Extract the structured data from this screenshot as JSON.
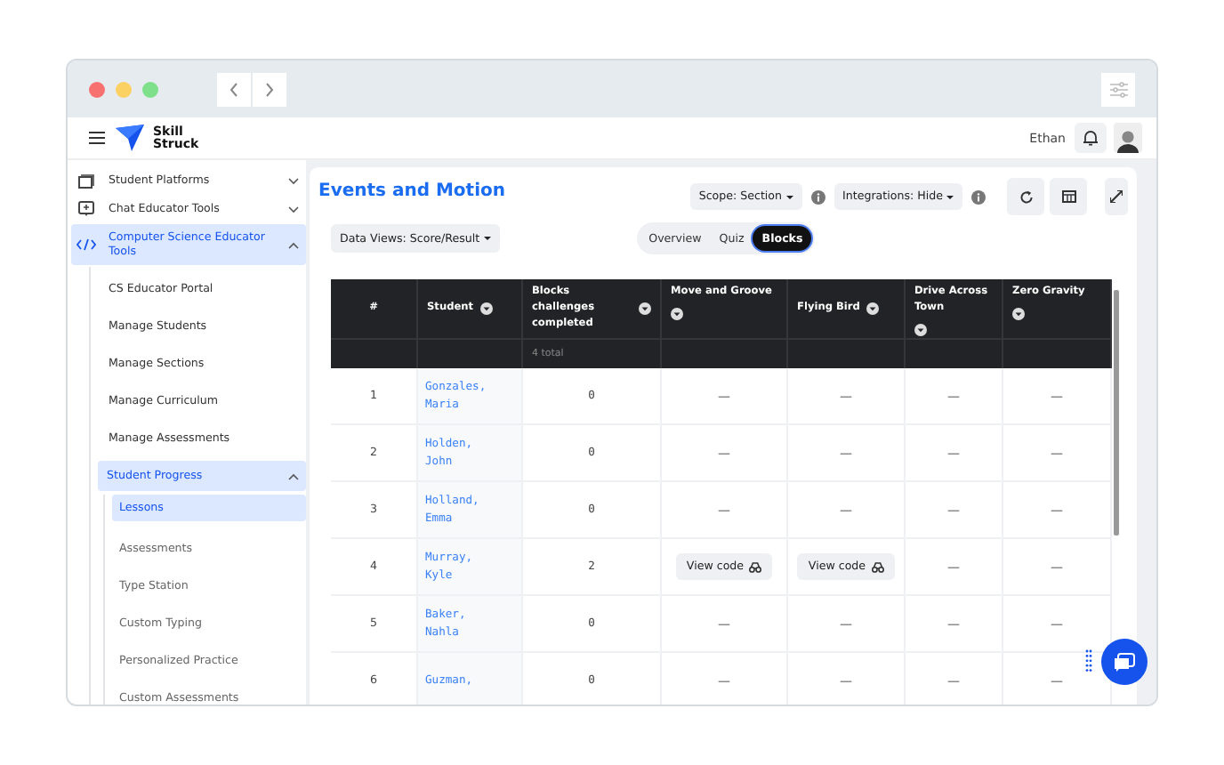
{
  "app_header": {
    "logo_text": [
      "Skill",
      "Struck"
    ],
    "user_name": "Ethan"
  },
  "sidebar": {
    "items": [
      {
        "label": "Student Platforms",
        "expanded": false,
        "selected": false
      },
      {
        "label": "Chat Educator Tools",
        "expanded": false,
        "selected": false
      },
      {
        "label": "Computer Science Educator Tools",
        "expanded": true,
        "selected": true,
        "children": [
          {
            "label": "CS Educator Portal",
            "selected": false
          },
          {
            "label": "Manage Students",
            "selected": false
          },
          {
            "label": "Manage Sections",
            "selected": false
          },
          {
            "label": "Manage Curriculum",
            "selected": false
          },
          {
            "label": "Manage Assessments",
            "selected": false
          },
          {
            "label": "Student Progress",
            "expanded": true,
            "selected": true,
            "children": [
              {
                "label": "Lessons",
                "selected": true
              },
              {
                "label": "Assessments",
                "selected": false
              },
              {
                "label": "Type Station",
                "selected": false
              },
              {
                "label": "Custom Typing",
                "selected": false
              },
              {
                "label": "Personalized Practice",
                "selected": false
              },
              {
                "label": "Custom Assessments",
                "selected": false
              }
            ]
          }
        ]
      }
    ]
  },
  "page": {
    "title": "Events and Motion",
    "dropdowns": [
      {
        "label": "Scope: Section"
      },
      {
        "label": "Integrations: Hide"
      }
    ],
    "data_views": "Data Views: Score/Result",
    "view_tabs": [
      {
        "label": "Overview",
        "selected": false
      },
      {
        "label": "Quiz",
        "selected": false
      },
      {
        "label": "Blocks",
        "selected": true
      }
    ]
  },
  "table": {
    "columns": [
      {
        "label": "#",
        "sortable": false
      },
      {
        "label": "Student",
        "sortable": true
      },
      {
        "label": "Blocks challenges completed",
        "sortable": true,
        "summary": "4 total"
      },
      {
        "label": "Move and Groove",
        "sortable": true
      },
      {
        "label": "Flying Bird",
        "sortable": true
      },
      {
        "label": "Drive Across Town",
        "sortable": true
      },
      {
        "label": "Zero Gravity",
        "sortable": true
      }
    ],
    "rows": [
      {
        "index": "1",
        "student": "Gonzales, Maria",
        "completed": "0",
        "challenges": [
          {
            "kind": "dash",
            "text": "—"
          },
          {
            "kind": "dash",
            "text": "—"
          },
          {
            "kind": "dash",
            "text": "—"
          },
          {
            "kind": "dash",
            "text": "—"
          }
        ]
      },
      {
        "index": "2",
        "student": "Holden, John",
        "completed": "0",
        "challenges": [
          {
            "kind": "dash",
            "text": "—"
          },
          {
            "kind": "dash",
            "text": "—"
          },
          {
            "kind": "dash",
            "text": "—"
          },
          {
            "kind": "dash",
            "text": "—"
          }
        ]
      },
      {
        "index": "3",
        "student": "Holland, Emma",
        "completed": "0",
        "challenges": [
          {
            "kind": "dash",
            "text": "—"
          },
          {
            "kind": "dash",
            "text": "—"
          },
          {
            "kind": "dash",
            "text": "—"
          },
          {
            "kind": "dash",
            "text": "—"
          }
        ]
      },
      {
        "index": "4",
        "student": "Murray, Kyle",
        "completed": "2",
        "challenges": [
          {
            "kind": "view",
            "text": "View code"
          },
          {
            "kind": "view",
            "text": "View code"
          },
          {
            "kind": "dash",
            "text": "—"
          },
          {
            "kind": "dash",
            "text": "—"
          }
        ]
      },
      {
        "index": "5",
        "student": "Baker, Nahla",
        "completed": "0",
        "challenges": [
          {
            "kind": "dash",
            "text": "—"
          },
          {
            "kind": "dash",
            "text": "—"
          },
          {
            "kind": "dash",
            "text": "—"
          },
          {
            "kind": "dash",
            "text": "—"
          }
        ]
      },
      {
        "index": "6",
        "student": "Guzman,",
        "completed": "0",
        "challenges": [
          {
            "kind": "dash",
            "text": "—"
          },
          {
            "kind": "dash",
            "text": "—"
          },
          {
            "kind": "dash",
            "text": "—"
          },
          {
            "kind": "dash",
            "text": "—"
          }
        ]
      }
    ]
  }
}
